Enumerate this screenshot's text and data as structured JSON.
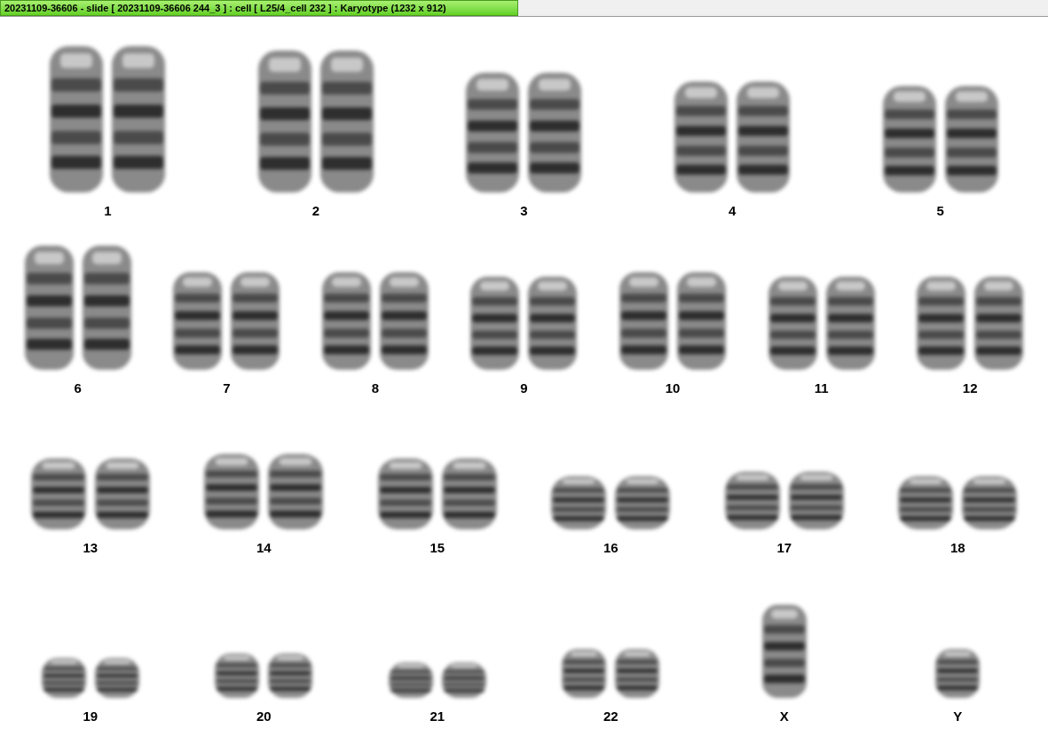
{
  "window": {
    "title": "20231109-36606 - slide [ 20231109-36606 244_3 ] : cell [ L25/4_cell 232 ] : Karyotype  (1232 x 912)"
  },
  "karyotype": {
    "rows": [
      [
        {
          "label": "1",
          "kind": "pair"
        },
        {
          "label": "2",
          "kind": "pair"
        },
        {
          "label": "3",
          "kind": "pair"
        },
        {
          "label": "4",
          "kind": "pair"
        },
        {
          "label": "5",
          "kind": "pair"
        }
      ],
      [
        {
          "label": "6",
          "kind": "pair"
        },
        {
          "label": "7",
          "kind": "pair"
        },
        {
          "label": "8",
          "kind": "pair"
        },
        {
          "label": "9",
          "kind": "pair"
        },
        {
          "label": "10",
          "kind": "pair"
        },
        {
          "label": "11",
          "kind": "pair"
        },
        {
          "label": "12",
          "kind": "pair"
        }
      ],
      [
        {
          "label": "13",
          "kind": "pair"
        },
        {
          "label": "14",
          "kind": "pair"
        },
        {
          "label": "15",
          "kind": "pair"
        },
        {
          "label": "16",
          "kind": "pair"
        },
        {
          "label": "17",
          "kind": "pair"
        },
        {
          "label": "18",
          "kind": "pair"
        }
      ],
      [
        {
          "label": "19",
          "kind": "pair"
        },
        {
          "label": "20",
          "kind": "pair"
        },
        {
          "label": "21",
          "kind": "pair"
        },
        {
          "label": "22",
          "kind": "pair"
        },
        {
          "label": "X",
          "kind": "single"
        },
        {
          "label": "Y",
          "kind": "single"
        }
      ]
    ]
  }
}
